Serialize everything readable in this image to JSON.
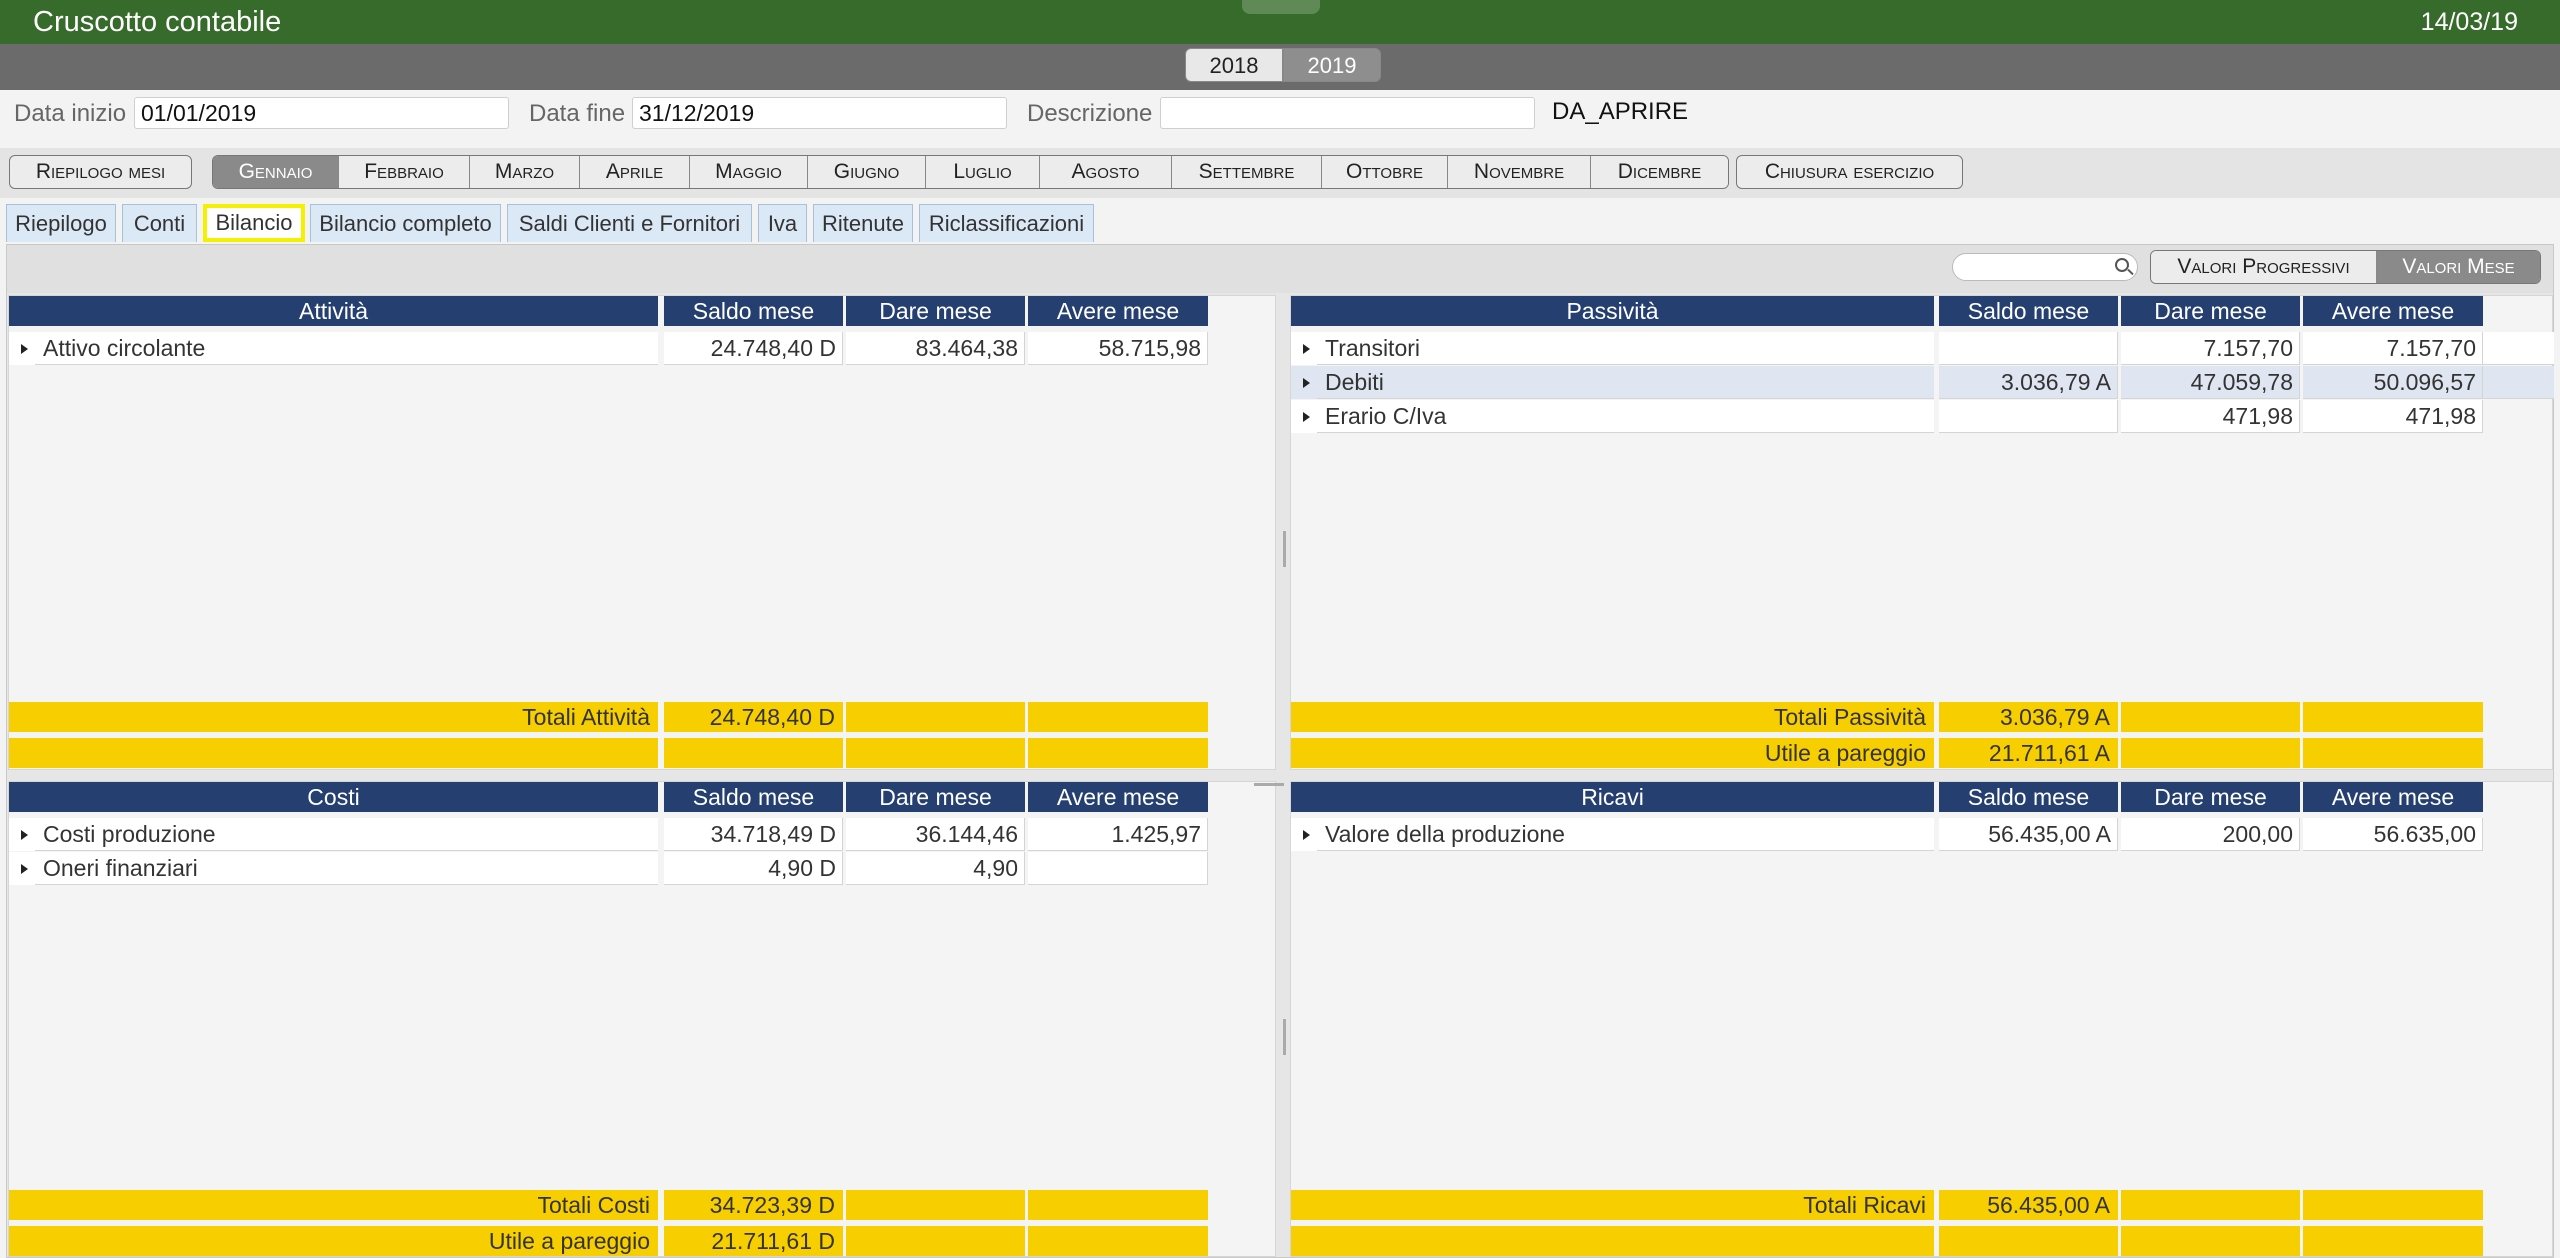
{
  "app": {
    "title": "Cruscotto contabile",
    "date": "14/03/19"
  },
  "years": [
    "2018",
    "2019"
  ],
  "filters": {
    "start_label": "Data inizio",
    "start_value": "01/01/2019",
    "end_label": "Data fine",
    "end_value": "31/12/2019",
    "desc_label": "Descrizione",
    "desc_value": "",
    "status": "DA_APRIRE"
  },
  "nav": {
    "summary": "Riepilogo mesi",
    "months": [
      "Gennaio",
      "Febbraio",
      "Marzo",
      "Aprile",
      "Maggio",
      "Giugno",
      "Luglio",
      "Agosto",
      "Settembre",
      "Ottobre",
      "Novembre",
      "Dicembre"
    ],
    "active_month": "Gennaio",
    "close": "Chiusura esercizio"
  },
  "tabs": [
    "Riepilogo",
    "Conti",
    "Bilancio",
    "Bilancio completo",
    "Saldi Clienti e Fornitori",
    "Iva",
    "Ritenute",
    "Riclassificazioni"
  ],
  "active_tab": "Bilancio",
  "toolbar": {
    "search_value": "",
    "progressive": "Valori Progressivi",
    "monthly": "Valori Mese",
    "active": "Valori Mese"
  },
  "panels": {
    "attivita": {
      "headers": [
        "Attività",
        "Saldo mese",
        "Dare mese",
        "Avere mese"
      ],
      "rows": [
        {
          "name": "Attivo circolante",
          "saldo": "24.748,40 D",
          "dare": "83.464,38",
          "avere": "58.715,98"
        }
      ],
      "totals": [
        {
          "label": "Totali Attività",
          "saldo": "24.748,40 D"
        },
        {
          "label": "",
          "saldo": ""
        }
      ]
    },
    "passivita": {
      "headers": [
        "Passività",
        "Saldo mese",
        "Dare mese",
        "Avere mese"
      ],
      "rows": [
        {
          "name": "Transitori",
          "saldo": "",
          "dare": "7.157,70",
          "avere": "7.157,70"
        },
        {
          "name": "Debiti",
          "saldo": "3.036,79 A",
          "dare": "47.059,78",
          "avere": "50.096,57"
        },
        {
          "name": "Erario C/Iva",
          "saldo": "",
          "dare": "471,98",
          "avere": "471,98"
        }
      ],
      "totals": [
        {
          "label": "Totali Passività",
          "saldo": "3.036,79 A"
        },
        {
          "label": "Utile a pareggio",
          "saldo": "21.711,61 A"
        }
      ]
    },
    "costi": {
      "headers": [
        "Costi",
        "Saldo mese",
        "Dare mese",
        "Avere mese"
      ],
      "rows": [
        {
          "name": "Costi produzione",
          "saldo": "34.718,49 D",
          "dare": "36.144,46",
          "avere": "1.425,97"
        },
        {
          "name": "Oneri finanziari",
          "saldo": "4,90 D",
          "dare": "4,90",
          "avere": ""
        }
      ],
      "totals": [
        {
          "label": "Totali Costi",
          "saldo": "34.723,39 D"
        },
        {
          "label": "Utile a pareggio",
          "saldo": "21.711,61 D"
        }
      ]
    },
    "ricavi": {
      "headers": [
        "Ricavi",
        "Saldo mese",
        "Dare mese",
        "Avere mese"
      ],
      "rows": [
        {
          "name": "Valore della produzione",
          "saldo": "56.435,00 A",
          "dare": "200,00",
          "avere": "56.635,00"
        }
      ],
      "totals": [
        {
          "label": "Totali Ricavi",
          "saldo": "56.435,00 A"
        },
        {
          "label": "",
          "saldo": ""
        }
      ]
    }
  }
}
